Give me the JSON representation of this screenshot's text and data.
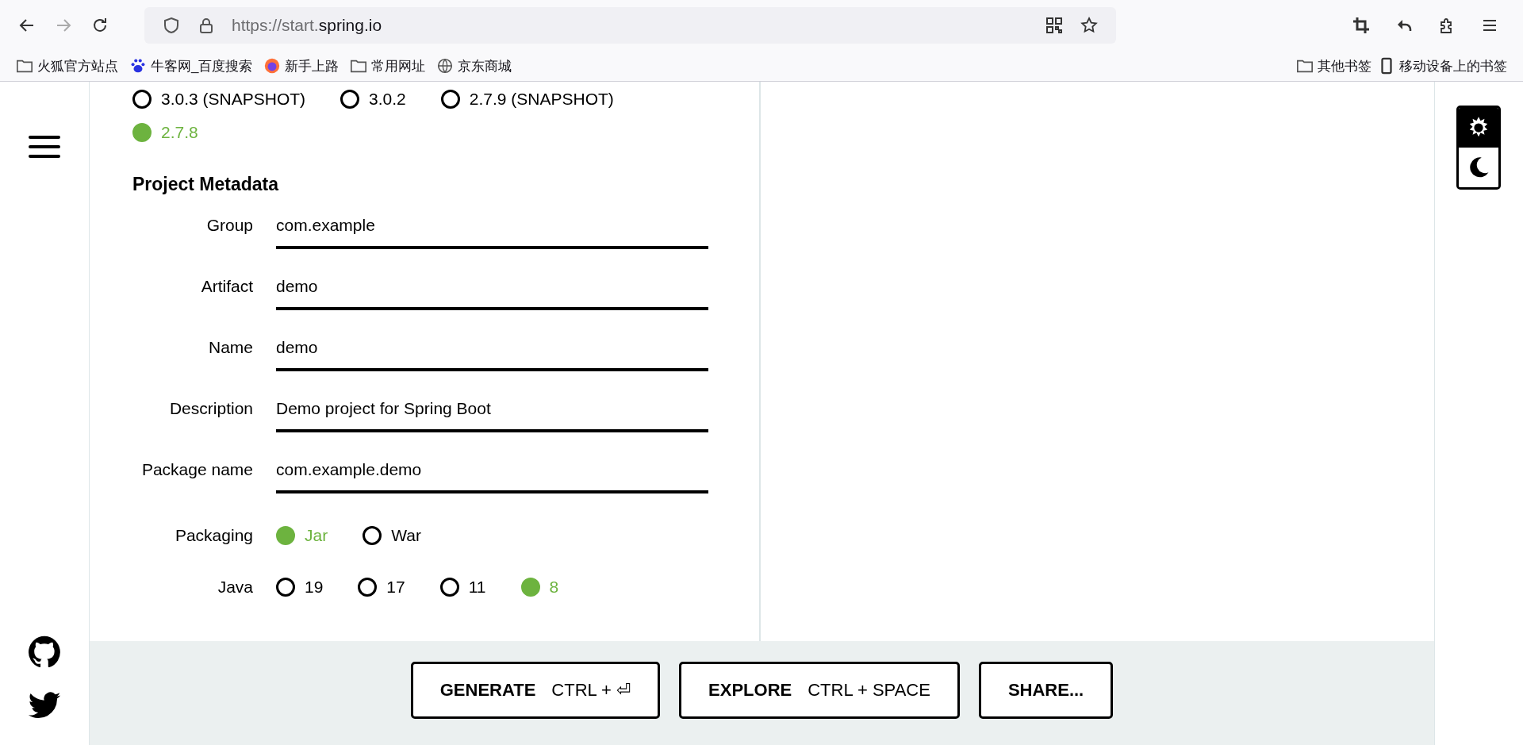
{
  "browser": {
    "url_prefix": "https://start.",
    "url_host": "spring.io",
    "bookmarks": [
      {
        "label": "火狐官方站点",
        "kind": "folder"
      },
      {
        "label": "牛客网_百度搜索",
        "kind": "paw"
      },
      {
        "label": "新手上路",
        "kind": "fox"
      },
      {
        "label": "常用网址",
        "kind": "folder"
      },
      {
        "label": "京东商城",
        "kind": "globe"
      }
    ],
    "other_bookmarks": [
      {
        "label": "其他书签",
        "kind": "folder"
      },
      {
        "label": "移动设备上的书签",
        "kind": "mobile"
      }
    ]
  },
  "spring_boot_versions": [
    {
      "label": "3.0.3 (SNAPSHOT)",
      "selected": false
    },
    {
      "label": "3.0.2",
      "selected": false
    },
    {
      "label": "2.7.9 (SNAPSHOT)",
      "selected": false
    },
    {
      "label": "2.7.8",
      "selected": true
    }
  ],
  "project_metadata": {
    "title": "Project Metadata",
    "fields": [
      {
        "label": "Group",
        "value": "com.example"
      },
      {
        "label": "Artifact",
        "value": "demo"
      },
      {
        "label": "Name",
        "value": "demo"
      },
      {
        "label": "Description",
        "value": "Demo project for Spring Boot"
      },
      {
        "label": "Package name",
        "value": "com.example.demo"
      }
    ],
    "choices": [
      {
        "label": "Packaging",
        "options": [
          {
            "label": "Jar",
            "selected": true
          },
          {
            "label": "War",
            "selected": false
          }
        ]
      },
      {
        "label": "Java",
        "options": [
          {
            "label": "19",
            "selected": false
          },
          {
            "label": "17",
            "selected": false
          },
          {
            "label": "11",
            "selected": false
          },
          {
            "label": "8",
            "selected": true
          }
        ]
      }
    ]
  },
  "actions": [
    {
      "label": "GENERATE",
      "shortcut": "CTRL + ⏎"
    },
    {
      "label": "EXPLORE",
      "shortcut": "CTRL + SPACE"
    },
    {
      "label": "SHARE..."
    }
  ]
}
